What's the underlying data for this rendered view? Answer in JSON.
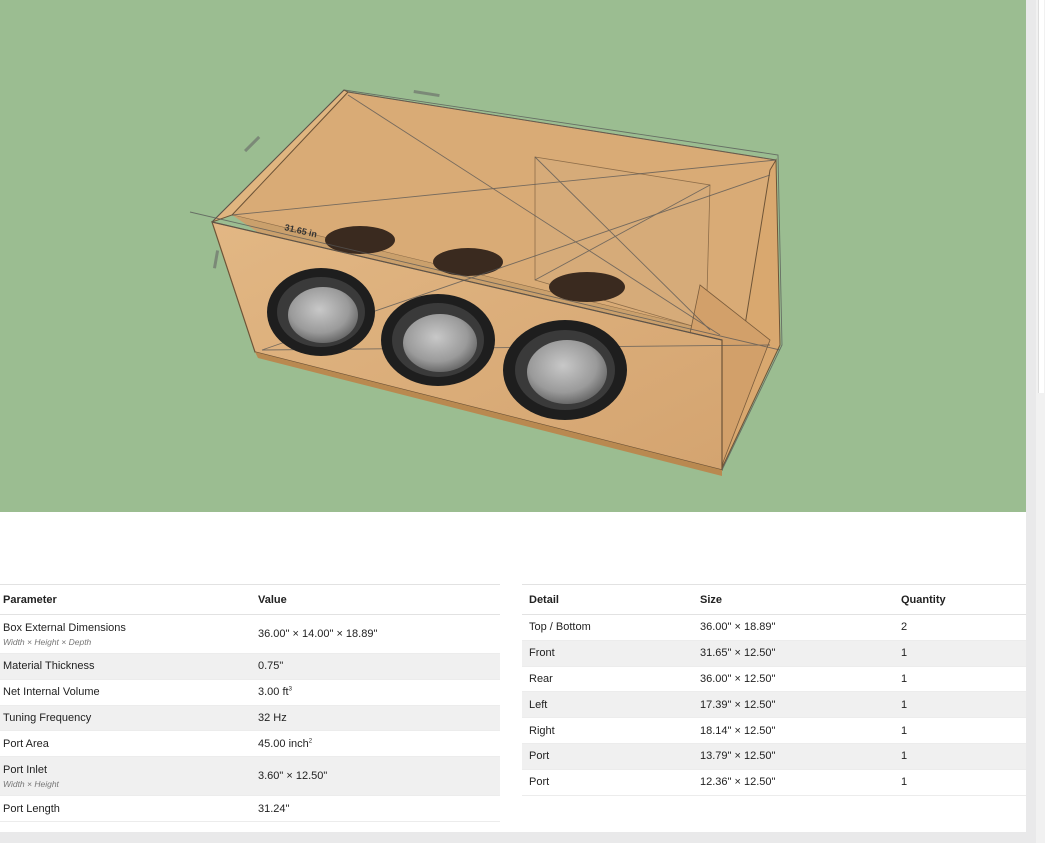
{
  "viewer": {
    "dimension_label": "31.65 in"
  },
  "parameters": {
    "headers": [
      "Parameter",
      "Value"
    ],
    "rows": [
      {
        "name": "Box External Dimensions",
        "sub": "Width × Height × Depth",
        "value": "36.00\" × 14.00\" × 18.89\""
      },
      {
        "name": "Material Thickness",
        "sub": "",
        "value": "0.75\""
      },
      {
        "name": "Net Internal Volume",
        "sub": "",
        "value": "3.00 ft",
        "unit_sup": "3"
      },
      {
        "name": "Tuning Frequency",
        "sub": "",
        "value": "32 Hz"
      },
      {
        "name": "Port Area",
        "sub": "",
        "value": "45.00 inch",
        "unit_sup": "2"
      },
      {
        "name": "Port Inlet",
        "sub": "Width × Height",
        "value": "3.60\" × 12.50\""
      },
      {
        "name": "Port Length",
        "sub": "",
        "value": "31.24\""
      }
    ]
  },
  "cut_list": {
    "headers": [
      "Detail",
      "Size",
      "Quantity"
    ],
    "rows": [
      {
        "detail": "Top / Bottom",
        "size": "36.00\" × 18.89\"",
        "qty": "2"
      },
      {
        "detail": "Front",
        "size": "31.65\" × 12.50\"",
        "qty": "1"
      },
      {
        "detail": "Rear",
        "size": "36.00\" × 12.50\"",
        "qty": "1"
      },
      {
        "detail": "Left",
        "size": "17.39\" × 12.50\"",
        "qty": "1"
      },
      {
        "detail": "Right",
        "size": "18.14\" × 12.50\"",
        "qty": "1"
      },
      {
        "detail": "Port",
        "size": "13.79\" × 12.50\"",
        "qty": "1"
      },
      {
        "detail": "Port",
        "size": "12.36\" × 12.50\"",
        "qty": "1"
      }
    ]
  }
}
